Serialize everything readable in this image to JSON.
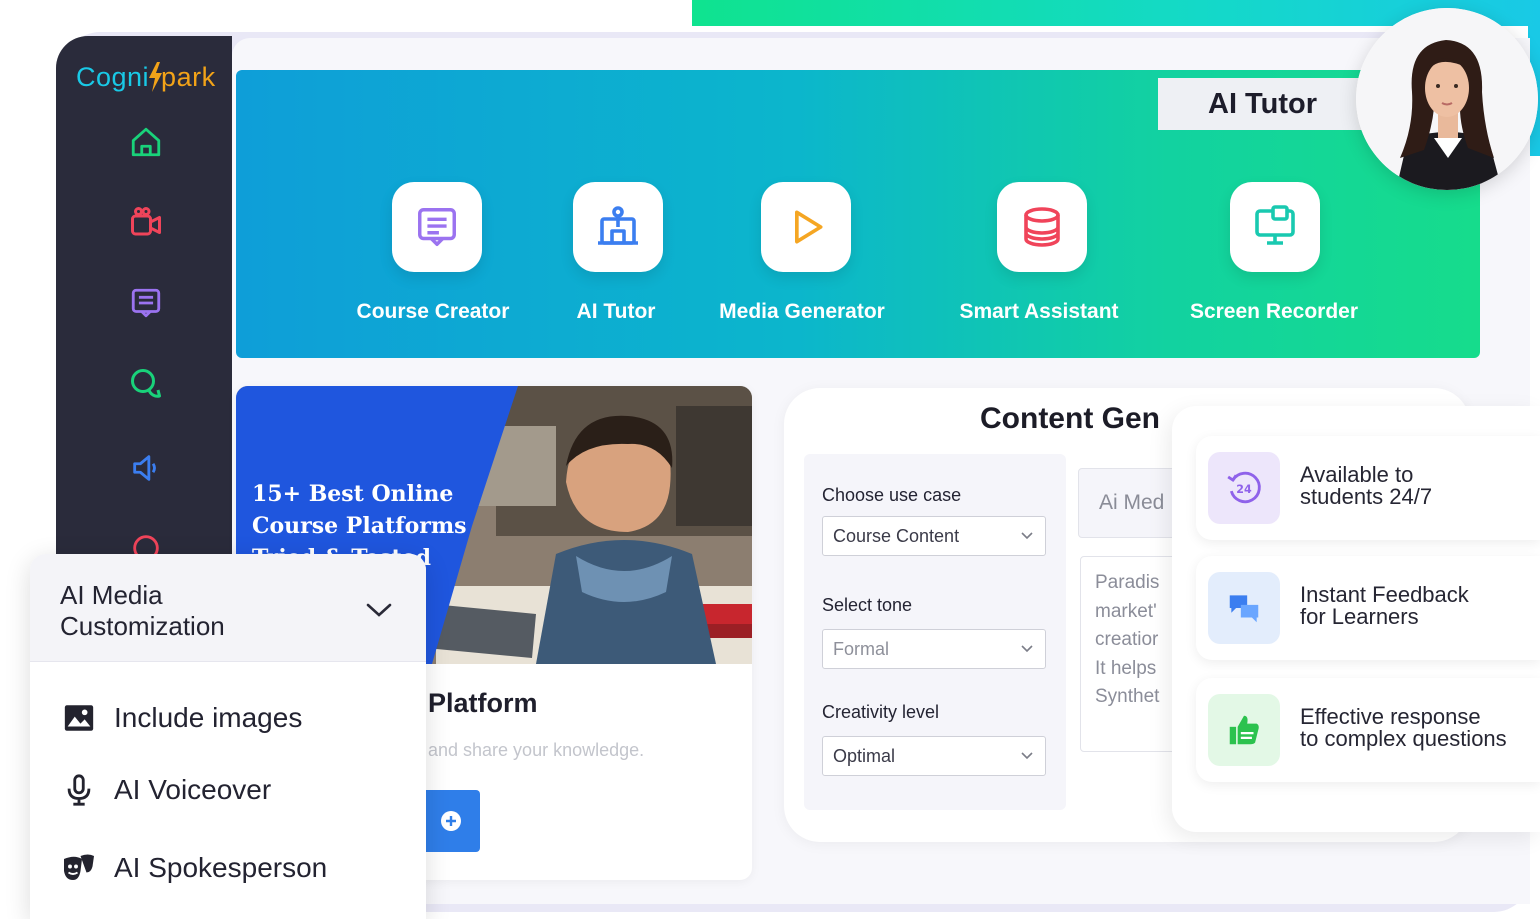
{
  "brand": {
    "name_part1": "Cogni",
    "name_part2": "park",
    "bolt_color": "#f2a318",
    "primary_color": "#19c9e6"
  },
  "sidebar": {
    "icons": [
      {
        "name": "home-icon",
        "color": "#19d27a"
      },
      {
        "name": "video-camera-icon",
        "color": "#f0445a"
      },
      {
        "name": "document-icon",
        "color": "#9b73f0"
      },
      {
        "name": "chat-bubbles-icon",
        "color": "#19d27a"
      },
      {
        "name": "speaker-icon",
        "color": "#3b7ef0"
      },
      {
        "name": "misc-icon",
        "color": "#f0445a"
      }
    ]
  },
  "banner": {
    "tools": [
      {
        "label": "Course Creator",
        "icon": "document-icon",
        "color": "#9b73f0"
      },
      {
        "label": "AI Tutor",
        "icon": "tutor-board-icon",
        "color": "#3b7ef0"
      },
      {
        "label": "Media Generator",
        "icon": "play-icon",
        "color": "#f5a623"
      },
      {
        "label": "Smart Assistant",
        "icon": "database-icon",
        "color": "#f0445a"
      },
      {
        "label": "Screen Recorder",
        "icon": "monitor-icon",
        "color": "#19c9b0"
      }
    ]
  },
  "tutor_badge": {
    "label": "AI Tutor"
  },
  "course_card": {
    "hero_line1": "15+ Best Online",
    "hero_line2": "Course Platforms",
    "hero_line3": "Tried & Tested",
    "title": "Platform",
    "description": "and share your knowledge."
  },
  "content_gen": {
    "title": "Content Gen",
    "use_case_label": "Choose use case",
    "use_case_value": "Course Content",
    "tone_label": "Select tone",
    "tone_value": "Formal",
    "creativity_label": "Creativity level",
    "creativity_value": "Optimal",
    "media_field_value": "Ai Med",
    "paragraph_lines": [
      "Paradis",
      "market'",
      "creatior",
      "It helps",
      "Synthet"
    ]
  },
  "features": [
    {
      "line1": "Available to",
      "line2": "students 24/7",
      "icon": "clock-24-icon",
      "icon_bg": "#ede6fb",
      "icon_color": "#8f62ea"
    },
    {
      "line1": "Instant Feedback",
      "line2": "for Learners",
      "icon": "chat-bubbles-icon",
      "icon_bg": "#e3edfc",
      "icon_color": "#3b7ef0"
    },
    {
      "line1": "Effective response",
      "line2": "to complex questions",
      "icon": "thumbs-up-icon",
      "icon_bg": "#e3f8e6",
      "icon_color": "#2cc24e"
    }
  ],
  "media_panel": {
    "title_line1": "AI Media",
    "title_line2": "Customization",
    "options": [
      {
        "label": "Include images",
        "icon": "image-icon"
      },
      {
        "label": "AI Voiceover",
        "icon": "microphone-icon"
      },
      {
        "label": "AI Spokesperson",
        "icon": "theater-mask-icon"
      }
    ]
  }
}
